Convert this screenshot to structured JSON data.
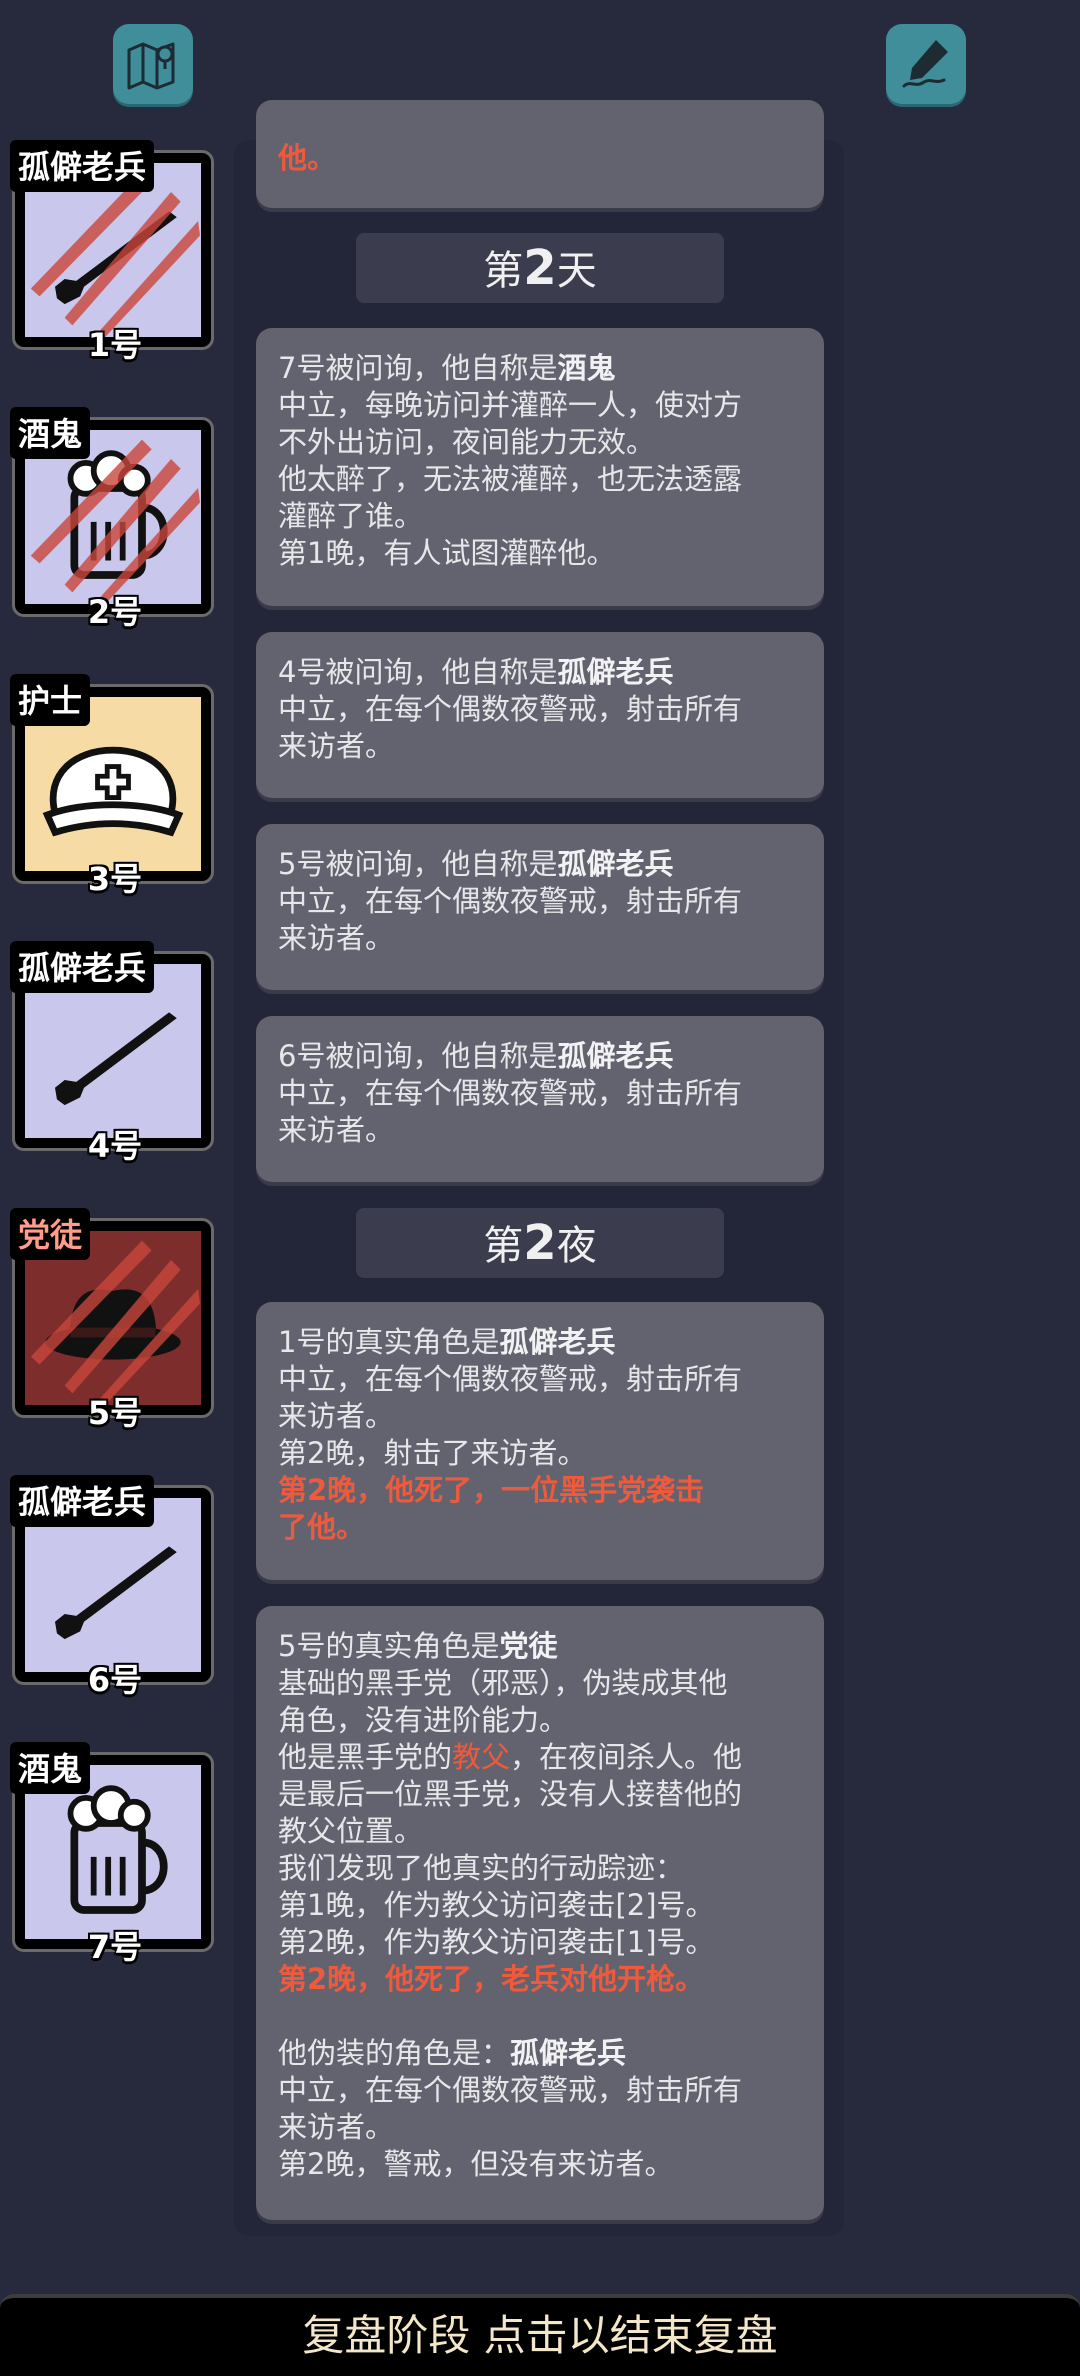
{
  "toolbar": {
    "map_icon": "map-icon",
    "pen_icon": "pen-edit-icon"
  },
  "players": [
    {
      "role": "孤僻老兵",
      "number": "1号",
      "art": "rifle-icon",
      "slashed": true
    },
    {
      "role": "酒鬼",
      "number": "2号",
      "art": "beer-mug-icon",
      "slashed": true
    },
    {
      "role": "护士",
      "number": "3号",
      "art": "nurse-cap-icon",
      "slashed": false
    },
    {
      "role": "孤僻老兵",
      "number": "4号",
      "art": "rifle-icon",
      "slashed": false
    },
    {
      "role": "党徒",
      "number": "5号",
      "art": "fedora-icon",
      "slashed": true
    },
    {
      "role": "孤僻老兵",
      "number": "6号",
      "art": "rifle-icon",
      "slashed": false
    },
    {
      "role": "酒鬼",
      "number": "7号",
      "art": "beer-mug-icon",
      "slashed": false
    }
  ],
  "log": {
    "prev_tail": "他。",
    "day2_header": {
      "pre": "第",
      "num": "2",
      "post": "天"
    },
    "night2_header": {
      "pre": "第",
      "num": "2",
      "post": "夜"
    },
    "day_entries": [
      {
        "intro": "7号被问询，他自称是",
        "role": "酒鬼",
        "lines": [
          "中立，每晚访问并灌醉一人，使对方",
          "不外出访问，夜间能力无效。",
          "他太醉了，无法被灌醉，也无法透露",
          "灌醉了谁。",
          "第1晚，有人试图灌醉他。"
        ]
      },
      {
        "intro": "4号被问询，他自称是",
        "role": "孤僻老兵",
        "lines": [
          "中立，在每个偶数夜警戒，射击所有",
          "来访者。"
        ]
      },
      {
        "intro": "5号被问询，他自称是",
        "role": "孤僻老兵",
        "lines": [
          "中立，在每个偶数夜警戒，射击所有",
          "来访者。"
        ]
      },
      {
        "intro": "6号被问询，他自称是",
        "role": "孤僻老兵",
        "lines": [
          "中立，在每个偶数夜警戒，射击所有",
          "来访者。"
        ]
      }
    ],
    "night_entry_1": {
      "intro": "1号的真实角色是",
      "role": "孤僻老兵",
      "lines": [
        "中立，在每个偶数夜警戒，射击所有",
        "来访者。",
        "第2晚，射击了来访者。"
      ],
      "death": [
        "第2晚，他死了，一位黑手党袭击",
        "了他。"
      ]
    },
    "night_entry_2": {
      "intro": "5号的真实角色是",
      "role": "党徒",
      "line1": "基础的黑手党（邪恶），伪装成其他",
      "line2": "角色，没有进阶能力。",
      "line3_pre": "他是黑手党的",
      "line3_hl": "教父",
      "line3_post": "，在夜间杀人。他",
      "line4": "是最后一位黑手党，没有人接替他的",
      "line5": "教父位置。",
      "line6": "我们发现了他真实的行动踪迹：",
      "line7": "第1晚，作为教父访问袭击[2]号。",
      "line8": "第2晚，作为教父访问袭击[1]号。",
      "death": "第2晚，他死了，老兵对他开枪。",
      "disguise_intro": "他伪装的角色是：",
      "disguise_role": "孤僻老兵",
      "line9": "中立，在每个偶数夜警戒，射击所有",
      "line10": "来访者。",
      "line11": "第2晚，警戒，但没有来访者。"
    }
  },
  "bottom_bar": {
    "label": "复盘阶段 点击以结束复盘"
  }
}
